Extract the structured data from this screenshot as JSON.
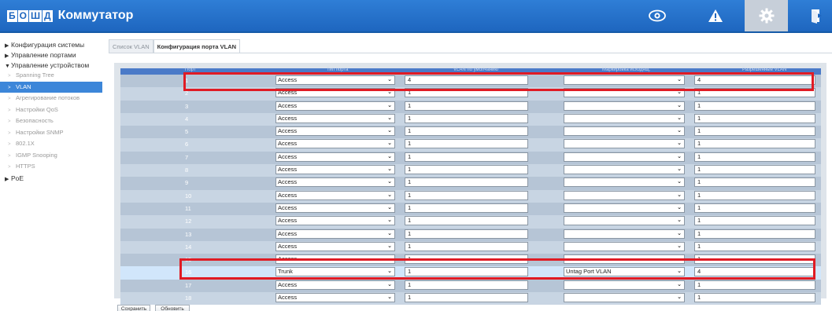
{
  "header": {
    "logo_letters": [
      "Б",
      "О",
      "Ш",
      "Д"
    ],
    "logo_text": "BOLID",
    "title": "Коммутатор",
    "icons": [
      "eye-icon",
      "warning-icon",
      "gear-icon",
      "logout-icon"
    ],
    "accent_color": "#1e66bf"
  },
  "sidebar": {
    "sections": [
      {
        "label": "Конфигурация системы",
        "expanded": false
      },
      {
        "label": "Управление портами",
        "expanded": false
      },
      {
        "label": "Управление устройством",
        "expanded": true
      },
      {
        "label": "PoE",
        "expanded": false
      }
    ],
    "items": [
      {
        "label": "Spanning Tree"
      },
      {
        "label": "VLAN"
      },
      {
        "label": "Агрегирование потоков"
      },
      {
        "label": "Настройки QoS"
      },
      {
        "label": "Безопасность"
      },
      {
        "label": "Настройки SNMP"
      },
      {
        "label": "802.1X"
      },
      {
        "label": "IGMP Snooping"
      },
      {
        "label": "HTTPS"
      }
    ],
    "active_item": "VLAN"
  },
  "tabs": [
    {
      "label": "Список VLAN",
      "active": false
    },
    {
      "label": "Конфигурация порта VLAN",
      "active": true
    }
  ],
  "table": {
    "headers": [
      "Порт",
      "Тип порта",
      "VLAN по умолчанию",
      "Маркировка исходящ.",
      "Разрешенные VLAN"
    ],
    "rows": [
      {
        "port": "1",
        "type": "Access",
        "vlan": "4",
        "mark": "",
        "allowed": "4"
      },
      {
        "port": "2",
        "type": "Access",
        "vlan": "1",
        "mark": "",
        "allowed": "1"
      },
      {
        "port": "3",
        "type": "Access",
        "vlan": "1",
        "mark": "",
        "allowed": "1"
      },
      {
        "port": "4",
        "type": "Access",
        "vlan": "1",
        "mark": "",
        "allowed": "1"
      },
      {
        "port": "5",
        "type": "Access",
        "vlan": "1",
        "mark": "",
        "allowed": "1"
      },
      {
        "port": "6",
        "type": "Access",
        "vlan": "1",
        "mark": "",
        "allowed": "1"
      },
      {
        "port": "7",
        "type": "Access",
        "vlan": "1",
        "mark": "",
        "allowed": "1"
      },
      {
        "port": "8",
        "type": "Access",
        "vlan": "1",
        "mark": "",
        "allowed": "1"
      },
      {
        "port": "9",
        "type": "Access",
        "vlan": "1",
        "mark": "",
        "allowed": "1"
      },
      {
        "port": "10",
        "type": "Access",
        "vlan": "1",
        "mark": "",
        "allowed": "1"
      },
      {
        "port": "11",
        "type": "Access",
        "vlan": "1",
        "mark": "",
        "allowed": "1"
      },
      {
        "port": "12",
        "type": "Access",
        "vlan": "1",
        "mark": "",
        "allowed": "1"
      },
      {
        "port": "13",
        "type": "Access",
        "vlan": "1",
        "mark": "",
        "allowed": "1"
      },
      {
        "port": "14",
        "type": "Access",
        "vlan": "1",
        "mark": "",
        "allowed": "1"
      },
      {
        "port": "15",
        "type": "Access",
        "vlan": "1",
        "mark": "",
        "allowed": "1"
      },
      {
        "port": "16",
        "type": "Trunk",
        "vlan": "1",
        "mark": "Untag Port VLAN",
        "allowed": "4"
      },
      {
        "port": "17",
        "type": "Access",
        "vlan": "1",
        "mark": "",
        "allowed": "1"
      },
      {
        "port": "18",
        "type": "Access",
        "vlan": "1",
        "mark": "",
        "allowed": "1"
      }
    ],
    "selected_row": "16",
    "highlighted_rows": [
      "1",
      "16"
    ],
    "highlight_color": "#e01b24"
  },
  "buttons": {
    "save": "Сохранить",
    "refresh": "Обновить"
  }
}
